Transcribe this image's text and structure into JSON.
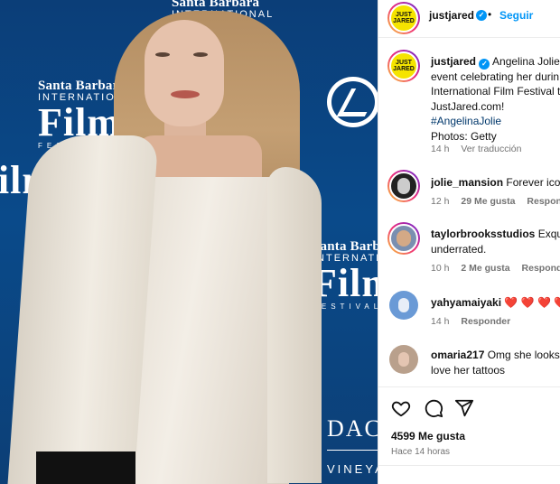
{
  "photo": {
    "backdrop": {
      "sb": "Santa Barbara",
      "intl": "INTERNATIONAL",
      "film": "Film",
      "fest": "FESTIVAL",
      "dac": "DAC",
      "vin": "VINEYA"
    }
  },
  "header": {
    "username": "justjared",
    "follow": "Seguir",
    "dot": "•",
    "avatar_text": "JUST JARED"
  },
  "caption": {
    "username": "justjared",
    "line1": "Angelina Jolie",
    "line2": "event celebrating her durin",
    "line3": "International Film Festival t",
    "line4": "JustJared.com!",
    "hashtag": "#AngelinaJolie",
    "credit": "Photos: Getty",
    "time": "14 h",
    "translate": "Ver traducción"
  },
  "comments": [
    {
      "username": "jolie_mansion",
      "text": "Forever icon",
      "time": "12 h",
      "likes": "29 Me gusta",
      "reply": "Responder"
    },
    {
      "username": "taylorbrooksstudios",
      "text": "Exqui",
      "text2": "underrated.",
      "time": "10 h",
      "likes": "2 Me gusta",
      "reply": "Responder"
    },
    {
      "username": "yahyamaiyaki",
      "text": "❤️ ❤️ ❤️ ❤️",
      "time": "14 h",
      "reply": "Responder"
    },
    {
      "username": "omaria217",
      "text": "Omg she looks",
      "text2": "love her tattoos"
    }
  ],
  "footer": {
    "likes": "4599 Me gusta",
    "ago": "Hace 14 horas"
  },
  "colors": {
    "accent": "#0095f6",
    "backdrop": "#0a4a8a",
    "heart": "#ed1c3a"
  }
}
